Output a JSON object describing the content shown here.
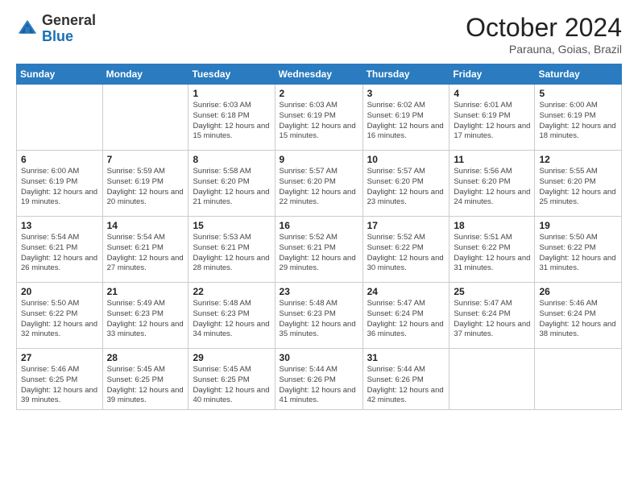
{
  "logo": {
    "general": "General",
    "blue": "Blue"
  },
  "title": "October 2024",
  "location": "Parauna, Goias, Brazil",
  "weekdays": [
    "Sunday",
    "Monday",
    "Tuesday",
    "Wednesday",
    "Thursday",
    "Friday",
    "Saturday"
  ],
  "weeks": [
    [
      {
        "day": "",
        "info": ""
      },
      {
        "day": "",
        "info": ""
      },
      {
        "day": "1",
        "info": "Sunrise: 6:03 AM\nSunset: 6:18 PM\nDaylight: 12 hours and 15 minutes."
      },
      {
        "day": "2",
        "info": "Sunrise: 6:03 AM\nSunset: 6:19 PM\nDaylight: 12 hours and 15 minutes."
      },
      {
        "day": "3",
        "info": "Sunrise: 6:02 AM\nSunset: 6:19 PM\nDaylight: 12 hours and 16 minutes."
      },
      {
        "day": "4",
        "info": "Sunrise: 6:01 AM\nSunset: 6:19 PM\nDaylight: 12 hours and 17 minutes."
      },
      {
        "day": "5",
        "info": "Sunrise: 6:00 AM\nSunset: 6:19 PM\nDaylight: 12 hours and 18 minutes."
      }
    ],
    [
      {
        "day": "6",
        "info": "Sunrise: 6:00 AM\nSunset: 6:19 PM\nDaylight: 12 hours and 19 minutes."
      },
      {
        "day": "7",
        "info": "Sunrise: 5:59 AM\nSunset: 6:19 PM\nDaylight: 12 hours and 20 minutes."
      },
      {
        "day": "8",
        "info": "Sunrise: 5:58 AM\nSunset: 6:20 PM\nDaylight: 12 hours and 21 minutes."
      },
      {
        "day": "9",
        "info": "Sunrise: 5:57 AM\nSunset: 6:20 PM\nDaylight: 12 hours and 22 minutes."
      },
      {
        "day": "10",
        "info": "Sunrise: 5:57 AM\nSunset: 6:20 PM\nDaylight: 12 hours and 23 minutes."
      },
      {
        "day": "11",
        "info": "Sunrise: 5:56 AM\nSunset: 6:20 PM\nDaylight: 12 hours and 24 minutes."
      },
      {
        "day": "12",
        "info": "Sunrise: 5:55 AM\nSunset: 6:20 PM\nDaylight: 12 hours and 25 minutes."
      }
    ],
    [
      {
        "day": "13",
        "info": "Sunrise: 5:54 AM\nSunset: 6:21 PM\nDaylight: 12 hours and 26 minutes."
      },
      {
        "day": "14",
        "info": "Sunrise: 5:54 AM\nSunset: 6:21 PM\nDaylight: 12 hours and 27 minutes."
      },
      {
        "day": "15",
        "info": "Sunrise: 5:53 AM\nSunset: 6:21 PM\nDaylight: 12 hours and 28 minutes."
      },
      {
        "day": "16",
        "info": "Sunrise: 5:52 AM\nSunset: 6:21 PM\nDaylight: 12 hours and 29 minutes."
      },
      {
        "day": "17",
        "info": "Sunrise: 5:52 AM\nSunset: 6:22 PM\nDaylight: 12 hours and 30 minutes."
      },
      {
        "day": "18",
        "info": "Sunrise: 5:51 AM\nSunset: 6:22 PM\nDaylight: 12 hours and 31 minutes."
      },
      {
        "day": "19",
        "info": "Sunrise: 5:50 AM\nSunset: 6:22 PM\nDaylight: 12 hours and 31 minutes."
      }
    ],
    [
      {
        "day": "20",
        "info": "Sunrise: 5:50 AM\nSunset: 6:22 PM\nDaylight: 12 hours and 32 minutes."
      },
      {
        "day": "21",
        "info": "Sunrise: 5:49 AM\nSunset: 6:23 PM\nDaylight: 12 hours and 33 minutes."
      },
      {
        "day": "22",
        "info": "Sunrise: 5:48 AM\nSunset: 6:23 PM\nDaylight: 12 hours and 34 minutes."
      },
      {
        "day": "23",
        "info": "Sunrise: 5:48 AM\nSunset: 6:23 PM\nDaylight: 12 hours and 35 minutes."
      },
      {
        "day": "24",
        "info": "Sunrise: 5:47 AM\nSunset: 6:24 PM\nDaylight: 12 hours and 36 minutes."
      },
      {
        "day": "25",
        "info": "Sunrise: 5:47 AM\nSunset: 6:24 PM\nDaylight: 12 hours and 37 minutes."
      },
      {
        "day": "26",
        "info": "Sunrise: 5:46 AM\nSunset: 6:24 PM\nDaylight: 12 hours and 38 minutes."
      }
    ],
    [
      {
        "day": "27",
        "info": "Sunrise: 5:46 AM\nSunset: 6:25 PM\nDaylight: 12 hours and 39 minutes."
      },
      {
        "day": "28",
        "info": "Sunrise: 5:45 AM\nSunset: 6:25 PM\nDaylight: 12 hours and 39 minutes."
      },
      {
        "day": "29",
        "info": "Sunrise: 5:45 AM\nSunset: 6:25 PM\nDaylight: 12 hours and 40 minutes."
      },
      {
        "day": "30",
        "info": "Sunrise: 5:44 AM\nSunset: 6:26 PM\nDaylight: 12 hours and 41 minutes."
      },
      {
        "day": "31",
        "info": "Sunrise: 5:44 AM\nSunset: 6:26 PM\nDaylight: 12 hours and 42 minutes."
      },
      {
        "day": "",
        "info": ""
      },
      {
        "day": "",
        "info": ""
      }
    ]
  ]
}
